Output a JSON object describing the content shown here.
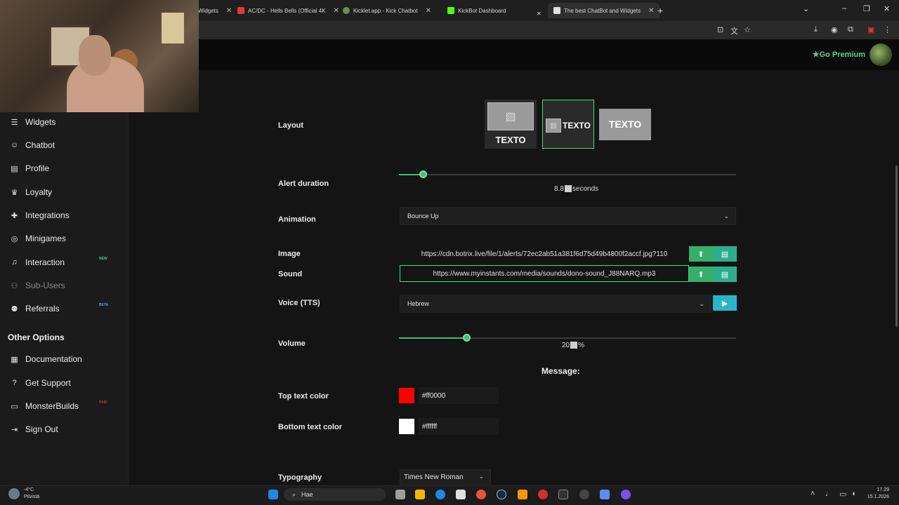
{
  "browser": {
    "tabs": [
      {
        "label": "Widgets"
      },
      {
        "label": "AC/DC - Hells Bells (Official 4K"
      },
      {
        "label": "Kicklet.app - Kick Chatbot"
      },
      {
        "label": "KickBot Dashboard"
      },
      {
        "label": "The best ChatBot and Widgets"
      }
    ],
    "new_tab": "+"
  },
  "header": {
    "premium_label": "Go Premium"
  },
  "sidebar": {
    "items": [
      {
        "label": "Widgets",
        "icon": "layers-icon"
      },
      {
        "label": "Chatbot",
        "icon": "robot-icon"
      },
      {
        "label": "Profile",
        "icon": "id-card-icon"
      },
      {
        "label": "Loyalty",
        "icon": "trophy-icon"
      },
      {
        "label": "Integrations",
        "icon": "puzzle-icon"
      },
      {
        "label": "Minigames",
        "icon": "gamepad-icon"
      },
      {
        "label": "Interaction",
        "icon": "music-note-icon",
        "badge": "NEW",
        "badge_color": "#3ddc84"
      },
      {
        "label": "Sub-Users",
        "icon": "users-icon",
        "disabled": true
      },
      {
        "label": "Referrals",
        "icon": "user-plus-icon",
        "badge": "BETA",
        "badge_color": "#4aa3ff"
      }
    ],
    "other_title": "Other Options",
    "other_items": [
      {
        "label": "Documentation",
        "icon": "document-icon"
      },
      {
        "label": "Get Support",
        "icon": "help-icon"
      },
      {
        "label": "MonsterBuilds",
        "icon": "monitor-icon",
        "badge": "PAID",
        "badge_color": "#c0392b"
      },
      {
        "label": "Sign Out",
        "icon": "sign-out-icon"
      }
    ]
  },
  "form": {
    "layout_label": "Layout",
    "layout_options": [
      "TEXTO",
      "TEXTO",
      "TEXTO"
    ],
    "layout_selected_index": 1,
    "alert_duration_label": "Alert duration",
    "alert_duration_value": "8.8",
    "alert_duration_unit": "seconds",
    "alert_duration_fraction": 0.07,
    "animation_label": "Animation",
    "animation_value": "Bounce Up",
    "image_label": "Image",
    "image_url": "https://cdn.botrix.live/file/1/alerts/72ec2ab51a381f6d75d49b4800f2accf.jpg?110",
    "sound_label": "Sound",
    "sound_url": "https://www.myinstants.com/media/sounds/dono-sound_J88NARQ.mp3",
    "voice_label": "Voice (TTS)",
    "voice_value": "Hebrew",
    "volume_label": "Volume",
    "volume_value": "20",
    "volume_unit": "%",
    "volume_fraction": 0.2,
    "message_title": "Message:",
    "top_color_label": "Top text color",
    "top_color_value": "#ff0000",
    "bottom_color_label": "Bottom text color",
    "bottom_color_value": "#ffffff",
    "typography_label": "Typography",
    "typography_value": "Times New Roman"
  },
  "taskbar": {
    "weather_temp": "-4°C",
    "weather_desc": "Pilvistä",
    "search_placeholder": "Hae",
    "time": "17.29",
    "date": "15.1.2026"
  }
}
